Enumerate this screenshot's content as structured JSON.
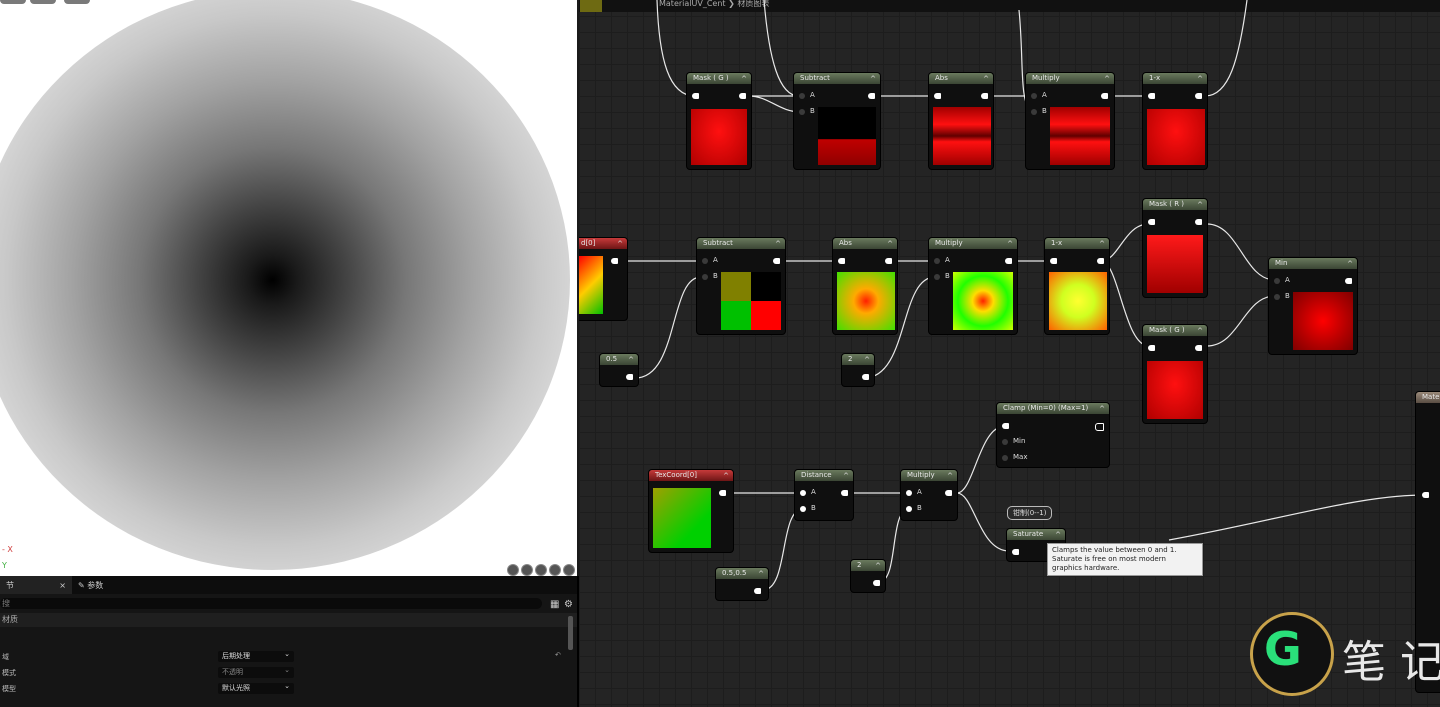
{
  "graph": {
    "breadcrumb": "MaterialUV_Cent ❯ 材质图表",
    "nodes": {
      "mask_g_top": "Mask ( G )",
      "subtract_top": "Subtract",
      "abs_top": "Abs",
      "multiply_top": "Multiply",
      "oneminus_top": "1-x",
      "texcoord_mid": "d[0]",
      "subtract_mid": "Subtract",
      "abs_mid": "Abs",
      "multiply_mid": "Multiply",
      "oneminus_mid": "1-x",
      "mask_r": "Mask ( R )",
      "mask_g_mid": "Mask ( G )",
      "min": "Min",
      "const_05": "0.5",
      "const_2a": "2",
      "clamp": "Clamp (Min=0) (Max=1)",
      "texcoord_bot": "TexCoord[0]",
      "distance": "Distance",
      "multiply_bot": "Multiply",
      "saturate": "Saturate",
      "const_0505": "0.5,0.5",
      "const_2b": "2",
      "material": "Mater"
    },
    "pins": {
      "a": "A",
      "b": "B",
      "min": "Min",
      "max": "Max"
    },
    "comment": "钳制(0--1)",
    "tooltip": "Clamps the value between 0 and 1. Saturate is free on most modern graphics hardware."
  },
  "viewport": {
    "axis_x": "- X",
    "axis_y": "Y"
  },
  "details": {
    "tab_details": "节",
    "tab_close": "×",
    "tab_params": "参数",
    "search_placeholder": "搜",
    "section": "材质",
    "rows": [
      {
        "label": "域",
        "value": "后期处理"
      },
      {
        "label": "模式",
        "value": "不透明"
      },
      {
        "label": "模型",
        "value": "默认光照"
      }
    ]
  },
  "watermark": {
    "letter": "G",
    "text": "笔 记"
  }
}
